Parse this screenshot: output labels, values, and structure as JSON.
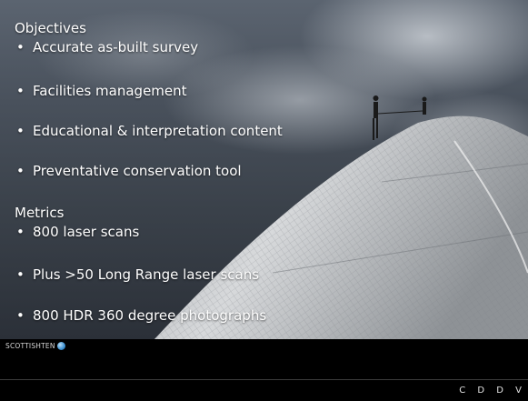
{
  "slide": {
    "objectives_heading": "Objectives",
    "objectives": [
      "Accurate as-built survey",
      "Facilities management",
      "Educational & interpretation content",
      "Preventative conservation tool"
    ],
    "metrics_heading": "Metrics",
    "metrics": [
      "800 laser scans",
      "Plus >50 Long Range laser scans",
      "800 HDR 360 degree photographs"
    ],
    "bullet_glyph": "•"
  },
  "footer": {
    "brand": "SCOTTISHTEN",
    "brand_icon": "globe-icon",
    "corner_text": "C D D V"
  },
  "colors": {
    "text": "#ffffff",
    "footer_bg": "#000000"
  }
}
